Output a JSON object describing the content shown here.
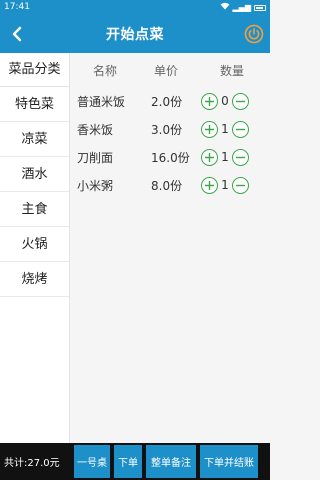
{
  "status_bar": {
    "time": "17:41",
    "signal": "▂▄▆"
  },
  "header": {
    "title": "开始点菜"
  },
  "sidebar": {
    "header": "菜品分类",
    "items": [
      {
        "label": "特色菜"
      },
      {
        "label": "凉菜"
      },
      {
        "label": "酒水"
      },
      {
        "label": "主食"
      },
      {
        "label": "火锅"
      },
      {
        "label": "烧烤"
      }
    ]
  },
  "table": {
    "columns": {
      "name": "名称",
      "price": "单价",
      "qty": "数量"
    },
    "rows": [
      {
        "name": "普通米饭",
        "price": "2.0份",
        "qty": "0"
      },
      {
        "name": "香米饭",
        "price": "3.0份",
        "qty": "1"
      },
      {
        "name": "刀削面",
        "price": "16.0份",
        "qty": "1"
      },
      {
        "name": "小米粥",
        "price": "8.0份",
        "qty": "1"
      }
    ]
  },
  "footer": {
    "total": "共计:27.0元",
    "buttons": {
      "table": "一号桌",
      "order": "下单",
      "note": "整单备注",
      "order_checkout": "下单并结账"
    }
  },
  "colors": {
    "primary": "#1e90c9",
    "qty_button": "#3aa84a",
    "footer_bg": "#111111"
  }
}
